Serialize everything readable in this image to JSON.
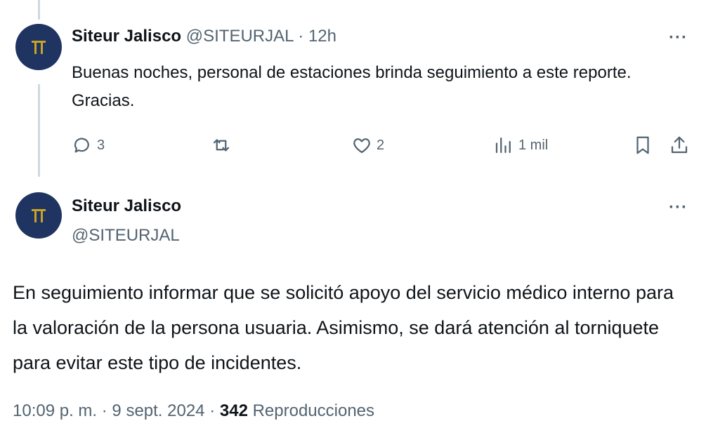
{
  "tweet1": {
    "display_name": "Siteur Jalisco",
    "handle": "@SITEURJAL",
    "separator": "·",
    "time": "12h",
    "more": "···",
    "text": "Buenas noches, personal de estaciones brinda seguimiento a este reporte. Gracias.",
    "actions": {
      "replies": "3",
      "retweets": "",
      "likes": "2",
      "views": "1 mil"
    }
  },
  "tweet2": {
    "display_name": "Siteur Jalisco",
    "handle": "@SITEURJAL",
    "more": "···",
    "text": "En seguimiento informar que se solicitó apoyo del servicio médico interno para la valoración de la persona usuaria. Asimismo, se dará atención al torniquete para evitar este tipo de incidentes.",
    "time": "10:09 p. m.",
    "date": "9 sept. 2024",
    "views_count": "342",
    "views_label": "Reproducciones"
  },
  "icons": [
    "reply-icon",
    "retweet-icon",
    "like-icon",
    "views-icon",
    "bookmark-icon",
    "share-icon"
  ],
  "colors": {
    "avatar_bg": "#1f3461",
    "logo": "#c9a227",
    "muted": "#536471",
    "text": "#0f1419"
  }
}
